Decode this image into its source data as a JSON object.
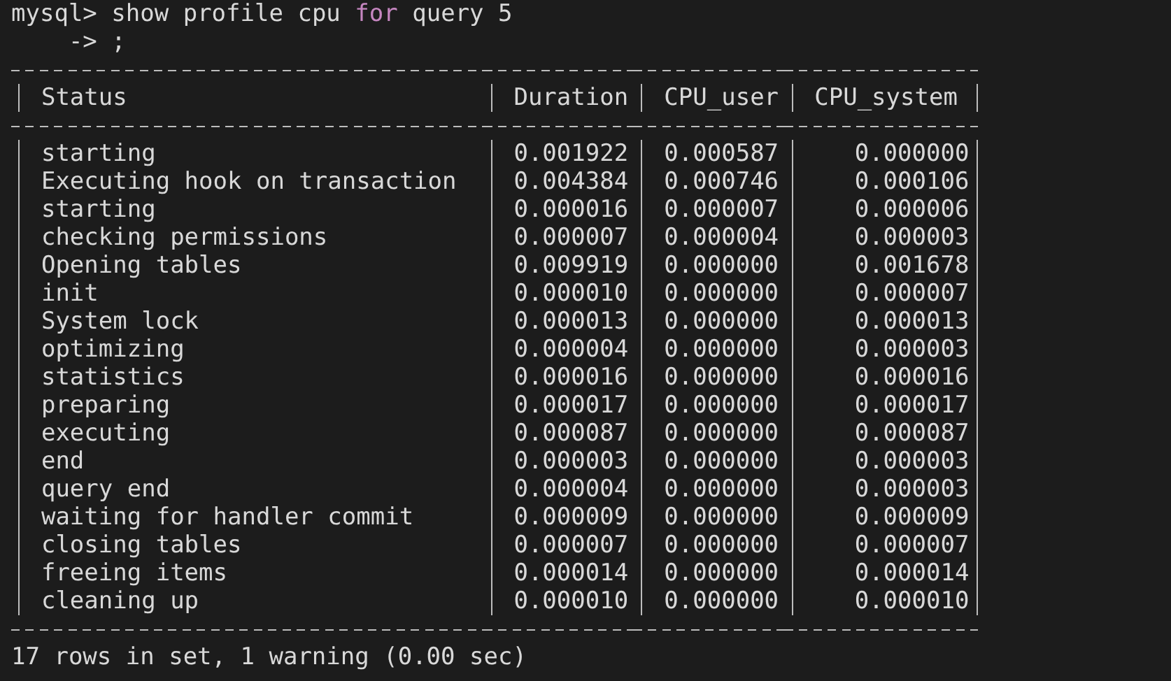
{
  "prompt": "mysql>",
  "command": [
    {
      "text": "show profile cpu ",
      "kind": "plain"
    },
    {
      "text": "for",
      "kind": "keyword"
    },
    {
      "text": " query 5",
      "kind": "plain"
    }
  ],
  "continuation": {
    "prompt": "->",
    "text": ";"
  },
  "table": {
    "columns": [
      {
        "label": "Status"
      },
      {
        "label": "Duration"
      },
      {
        "label": "CPU_user"
      },
      {
        "label": "CPU_system"
      }
    ],
    "rows": [
      [
        "starting",
        "0.001922",
        "0.000587",
        "0.000000"
      ],
      [
        "Executing hook on transaction",
        "0.004384",
        "0.000746",
        "0.000106"
      ],
      [
        "starting",
        "0.000016",
        "0.000007",
        "0.000006"
      ],
      [
        "checking permissions",
        "0.000007",
        "0.000004",
        "0.000003"
      ],
      [
        "Opening tables",
        "0.009919",
        "0.000000",
        "0.001678"
      ],
      [
        "init",
        "0.000010",
        "0.000000",
        "0.000007"
      ],
      [
        "System lock",
        "0.000013",
        "0.000000",
        "0.000013"
      ],
      [
        "optimizing",
        "0.000004",
        "0.000000",
        "0.000003"
      ],
      [
        "statistics",
        "0.000016",
        "0.000000",
        "0.000016"
      ],
      [
        "preparing",
        "0.000017",
        "0.000000",
        "0.000017"
      ],
      [
        "executing",
        "0.000087",
        "0.000000",
        "0.000087"
      ],
      [
        "end",
        "0.000003",
        "0.000000",
        "0.000003"
      ],
      [
        "query end",
        "0.000004",
        "0.000000",
        "0.000003"
      ],
      [
        "waiting for handler commit",
        "0.000009",
        "0.000000",
        "0.000009"
      ],
      [
        "closing tables",
        "0.000007",
        "0.000000",
        "0.000007"
      ],
      [
        "freeing items",
        "0.000014",
        "0.000000",
        "0.000014"
      ],
      [
        "cleaning up",
        "0.000010",
        "0.000000",
        "0.000010"
      ]
    ]
  },
  "summary": "17 rows in set, 1 warning (0.00 sec)"
}
